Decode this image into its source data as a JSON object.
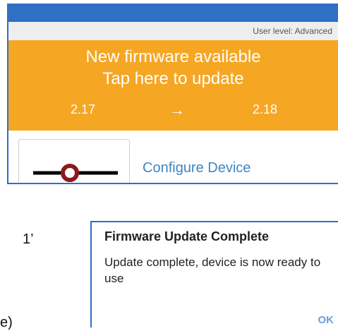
{
  "app": {
    "user_level": "User level: Advanced"
  },
  "banner": {
    "line1": "New firmware available",
    "line2": "Tap here to update",
    "from_version": "2.17",
    "to_version": "2.18",
    "arrow": "→"
  },
  "device": {
    "configure_label": "Configure Device"
  },
  "side": {
    "marker": "1’",
    "partial": "e)"
  },
  "dialog": {
    "title": "Firmware Update Complete",
    "message": "Update complete, device is now ready to use",
    "ok_label": "OK"
  },
  "colors": {
    "accent_blue": "#2f6fc4",
    "banner_orange": "#f5a623",
    "link_blue": "#3e86c4",
    "device_red": "#8b1a1a"
  },
  "icons": {
    "device": "valve-symbol-icon",
    "arrow": "right-arrow-icon"
  }
}
